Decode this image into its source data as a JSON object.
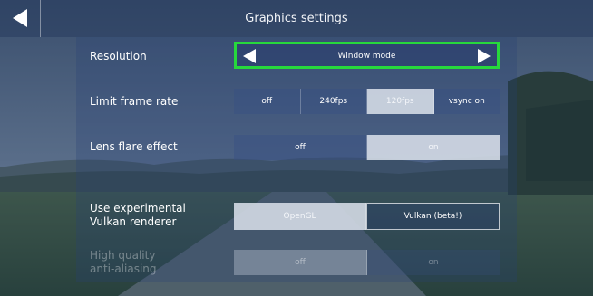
{
  "header": {
    "title": "Graphics settings",
    "back_icon": "back-arrow-icon"
  },
  "colors": {
    "highlight_border": "#27d83c",
    "selected_option": "#d7dee8"
  },
  "settings": {
    "resolution": {
      "label": "Resolution",
      "value": "Window mode",
      "prev_icon": "arrow-left-icon",
      "next_icon": "arrow-right-icon",
      "focused": true
    },
    "frame_rate": {
      "label": "Limit frame rate",
      "options": [
        "off",
        "240fps",
        "120fps",
        "vsync on"
      ],
      "selected": "120fps"
    },
    "lens_flare": {
      "label": "Lens flare effect",
      "options": [
        "off",
        "on"
      ],
      "selected": "on"
    },
    "vulkan": {
      "label_line1": "Use experimental",
      "label_line2": "Vulkan renderer",
      "options": [
        "OpenGL",
        "Vulkan (beta!)"
      ],
      "selected": "OpenGL"
    },
    "antialiasing": {
      "label_line1": "High quality",
      "label_line2": "anti-aliasing",
      "options": [
        "off",
        "on"
      ],
      "selected": "off",
      "disabled": true
    }
  }
}
